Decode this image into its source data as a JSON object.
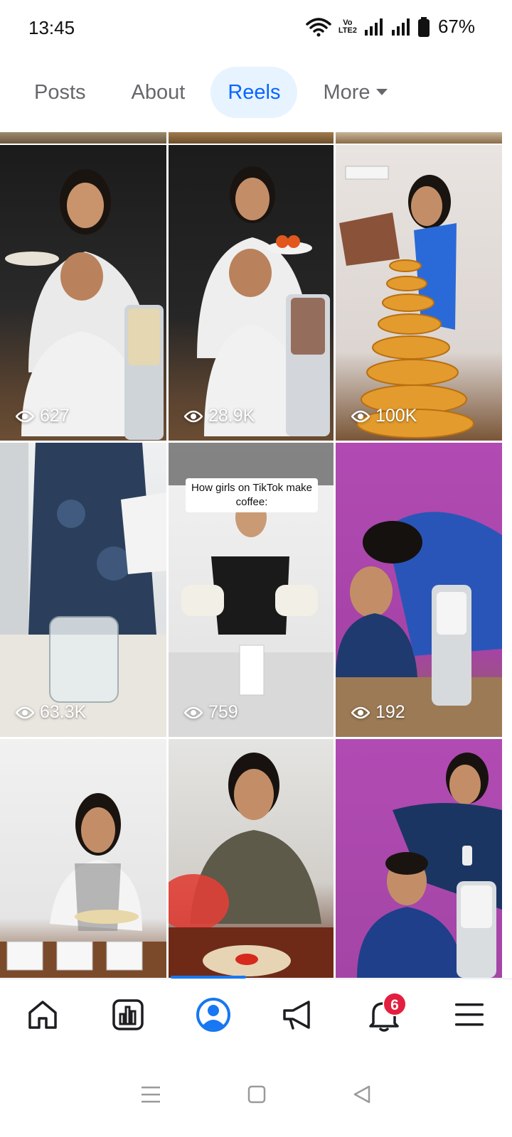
{
  "status_bar": {
    "time": "13:45",
    "battery": "67%",
    "volte_top": "Vo",
    "volte_bottom": "LTE2"
  },
  "tabs": [
    {
      "label": "Posts",
      "active": false
    },
    {
      "label": "About",
      "active": false
    },
    {
      "label": "Reels",
      "active": true
    },
    {
      "label": "More",
      "active": false
    }
  ],
  "reels": [
    {
      "views": "627"
    },
    {
      "views": "28.9K"
    },
    {
      "views": "100K"
    },
    {
      "views": "63.3K"
    },
    {
      "views": "759",
      "caption": "How girls on TikTok make coffee:"
    },
    {
      "views": "192"
    },
    {
      "views": ""
    },
    {
      "views": ""
    },
    {
      "views": ""
    }
  ],
  "bottom_nav": {
    "items": [
      "home-icon",
      "insights-icon",
      "profile-icon",
      "megaphone-icon",
      "bell-icon",
      "menu-icon"
    ],
    "notifications_badge": "6",
    "accent": "#1877f2"
  }
}
